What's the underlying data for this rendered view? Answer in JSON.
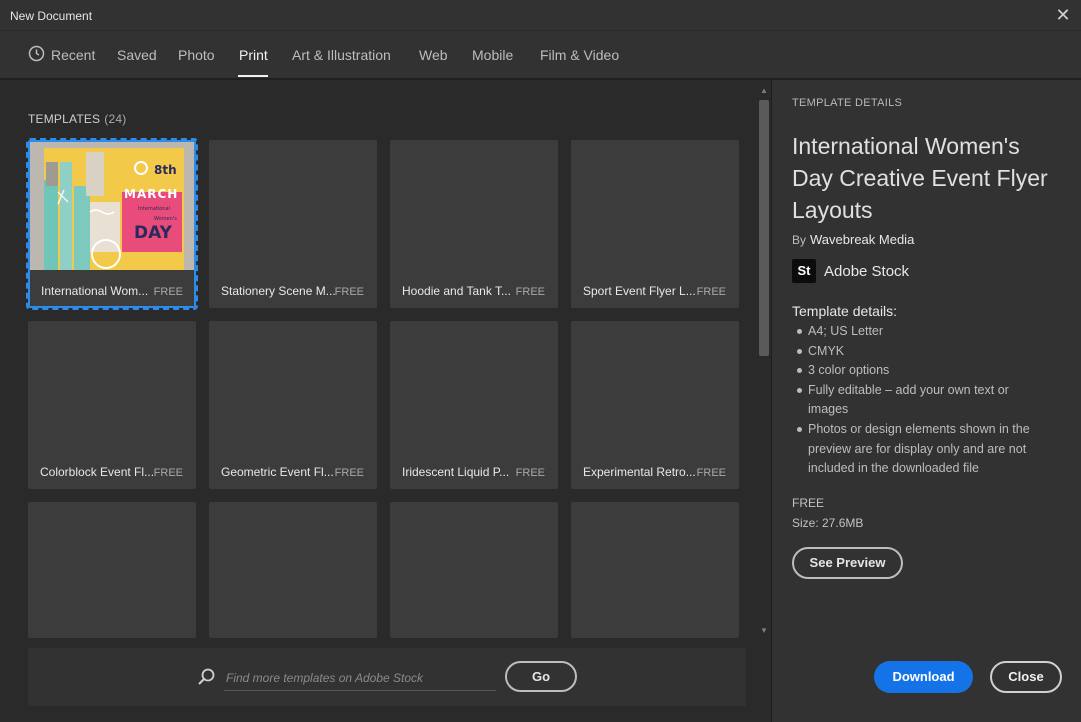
{
  "window": {
    "title": "New Document"
  },
  "tabs": [
    {
      "label": "Recent",
      "active": false
    },
    {
      "label": "Saved",
      "active": false
    },
    {
      "label": "Photo",
      "active": false
    },
    {
      "label": "Print",
      "active": true
    },
    {
      "label": "Art & Illustration",
      "active": false
    },
    {
      "label": "Web",
      "active": false
    },
    {
      "label": "Mobile",
      "active": false
    },
    {
      "label": "Film & Video",
      "active": false
    }
  ],
  "templates": {
    "label": "TEMPLATES",
    "count": "(24)",
    "items": [
      {
        "name": "International Wom...",
        "badge": "FREE",
        "selected": true
      },
      {
        "name": "Stationery Scene M...",
        "badge": "FREE"
      },
      {
        "name": "Hoodie and Tank T...",
        "badge": "FREE"
      },
      {
        "name": "Sport Event Flyer L...",
        "badge": "FREE"
      },
      {
        "name": "Colorblock Event Fl...",
        "badge": "FREE"
      },
      {
        "name": "Geometric Event Fl...",
        "badge": "FREE"
      },
      {
        "name": "Iridescent Liquid P...",
        "badge": "FREE"
      },
      {
        "name": "Experimental Retro...",
        "badge": "FREE"
      },
      {
        "name": "",
        "badge": ""
      },
      {
        "name": "",
        "badge": ""
      },
      {
        "name": "",
        "badge": ""
      },
      {
        "name": "",
        "badge": ""
      }
    ]
  },
  "thumbnail_text": {
    "line1": "8th",
    "line2": "MARCH",
    "line3": "International",
    "line4": "Women's",
    "line5": "DAY"
  },
  "search": {
    "placeholder": "Find more templates on Adobe Stock",
    "go_label": "Go"
  },
  "details": {
    "section_label": "TEMPLATE DETAILS",
    "title": "International Women's Day Creative Event Flyer Layouts",
    "by_label": "By",
    "author": "Wavebreak Media",
    "stock_logo": "St",
    "stock_name": "Adobe Stock",
    "heading": "Template details:",
    "bullets": [
      "A4; US Letter",
      "CMYK",
      "3 color options",
      "Fully editable – add your own text or images",
      "Photos or design elements shown in the preview are for display only and are not included in the downloaded file"
    ],
    "price": "FREE",
    "size": "Size: 27.6MB",
    "see_preview_label": "See Preview"
  },
  "footer": {
    "download_label": "Download",
    "close_label": "Close"
  },
  "colors": {
    "accent": "#1473e6",
    "selection": "#2d8ceb",
    "panel": "#323232",
    "card": "#3c3c3c"
  },
  "icons": {
    "close": "close-icon",
    "clock": "clock-icon",
    "search": "search-icon"
  }
}
